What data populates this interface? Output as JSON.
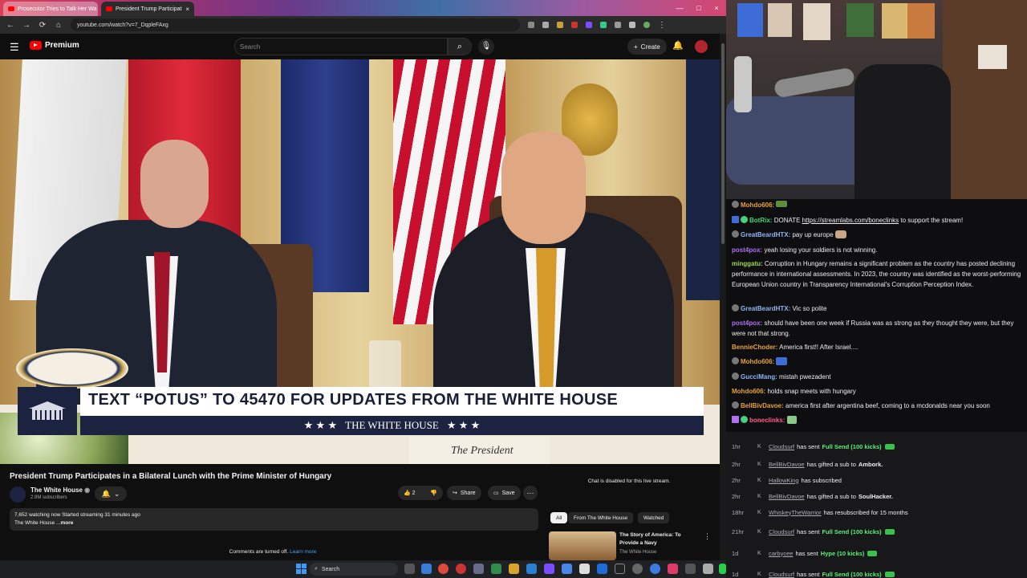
{
  "browser": {
    "tabs": [
      {
        "label": "Prosecutor Tries to Talk Her Wa",
        "active": false
      },
      {
        "label": "President Trump Participat",
        "active": true
      }
    ],
    "url": "youtube.com/watch?v=7_DqpleFAxg"
  },
  "youtube": {
    "logo_label": "Premium",
    "search_placeholder": "Search",
    "create_label": "Create",
    "video": {
      "lower_third_text": "TEXT “POTUS” TO 45470 FOR UPDATES FROM THE WHITE HOUSE",
      "lower_third_brand": "THE WHITE HOUSE",
      "stars": "★ ★ ★",
      "placecard": "The President"
    },
    "title": "President Trump Participates in a Bilateral Lunch with the Prime Minister of Hungary",
    "channel": {
      "name": "The White House",
      "subs": "2.8M subscribers"
    },
    "likes": "2",
    "share_label": "Share",
    "save_label": "Save",
    "description": {
      "stats": "7,652 watching now  Started streaming 31 minutes ago",
      "line2": "The White House ...",
      "more": "more"
    },
    "comments_off": "Comments are turned off.",
    "learn_more": "Learn more",
    "chat_disabled": "Chat is disabled for this live stream.",
    "chips": [
      "All",
      "From The White House",
      "Watched"
    ],
    "recommendation": {
      "title": "The Story of America: To Provide a Navy",
      "channel": "The White House"
    }
  },
  "chat": [
    {
      "user": "Mohdo606:",
      "text": "",
      "color": "#e6a23c"
    },
    {
      "user": "BotRix:",
      "text": "DONATE ",
      "link": "https://streamlabs.com/boneclinks",
      "after": " to support the stream!",
      "color": "#45d27a"
    },
    {
      "user": "GreatBeardHTX:",
      "text": "pay up europe",
      "color": "#8fb5f2"
    },
    {
      "user": "post4pox:",
      "text": "yeah losing your soldiers is not winning.",
      "color": "#b070f0"
    },
    {
      "user": "minggatu:",
      "text": "Corruption in Hungary remains a significant problem as the country has posted declining performance in international assessments. In 2023, the country was identified as the worst-performing European Union country in Transparency International's Corruption Perception Index.",
      "color": "#9ad94b"
    },
    {
      "user": "GreatBeardHTX:",
      "text": "Vic so polite",
      "color": "#8fb5f2"
    },
    {
      "user": "post4pox:",
      "text": "should have been one week if Russia was as strong as they thought they were, but they were not that strong.",
      "color": "#b070f0"
    },
    {
      "user": "BennieChoder:",
      "text": "America first!! After Israel....",
      "color": "#e6a23c"
    },
    {
      "user": "Mohdo606:",
      "text": "",
      "color": "#e6a23c"
    },
    {
      "user": "GucciMang:",
      "text": "mistah pwezadent",
      "color": "#8fb5f2"
    },
    {
      "user": "Mohdo606:",
      "text": "holds snap meets with hungary",
      "color": "#e6a23c"
    },
    {
      "user": "BellBivDavoe:",
      "text": "america first after argentina beef, coming to a mcdonalds near you soon",
      "color": "#e6a23c"
    },
    {
      "user": "boneclinks:",
      "text": "",
      "color": "#ff5c8a"
    }
  ],
  "events": [
    {
      "time": "1hr",
      "user": "Cloudsurf",
      "text": "has sent",
      "highlight": "Full Send (100 kicks)",
      "money": true
    },
    {
      "time": "2hr",
      "user": "BellBivDavoe",
      "text": "has gifted a sub to",
      "bold": "Ambork."
    },
    {
      "time": "2hr",
      "user": "HallowKing",
      "text": "has subscribed"
    },
    {
      "time": "2hr",
      "user": "BellBivDavoe",
      "text": "has gifted a sub to",
      "bold": "SoulHacker."
    },
    {
      "time": "18hr",
      "user": "WhiskeyTheWarrior",
      "text": "has resubscribed for 15 months"
    },
    {
      "time": "21hr",
      "user": "Cloudsurf",
      "text": "has sent",
      "highlight": "Full Send (100 kicks)",
      "money": true
    },
    {
      "time": "1d",
      "user": "carbycee",
      "text": "has sent",
      "highlight": "Hype (10 kicks)",
      "money": true
    },
    {
      "time": "1d",
      "user": "Cloudsurf",
      "text": "has sent",
      "highlight": "Full Send (100 kicks)",
      "money": true
    }
  ],
  "taskbar": {
    "search_label": "Search"
  }
}
